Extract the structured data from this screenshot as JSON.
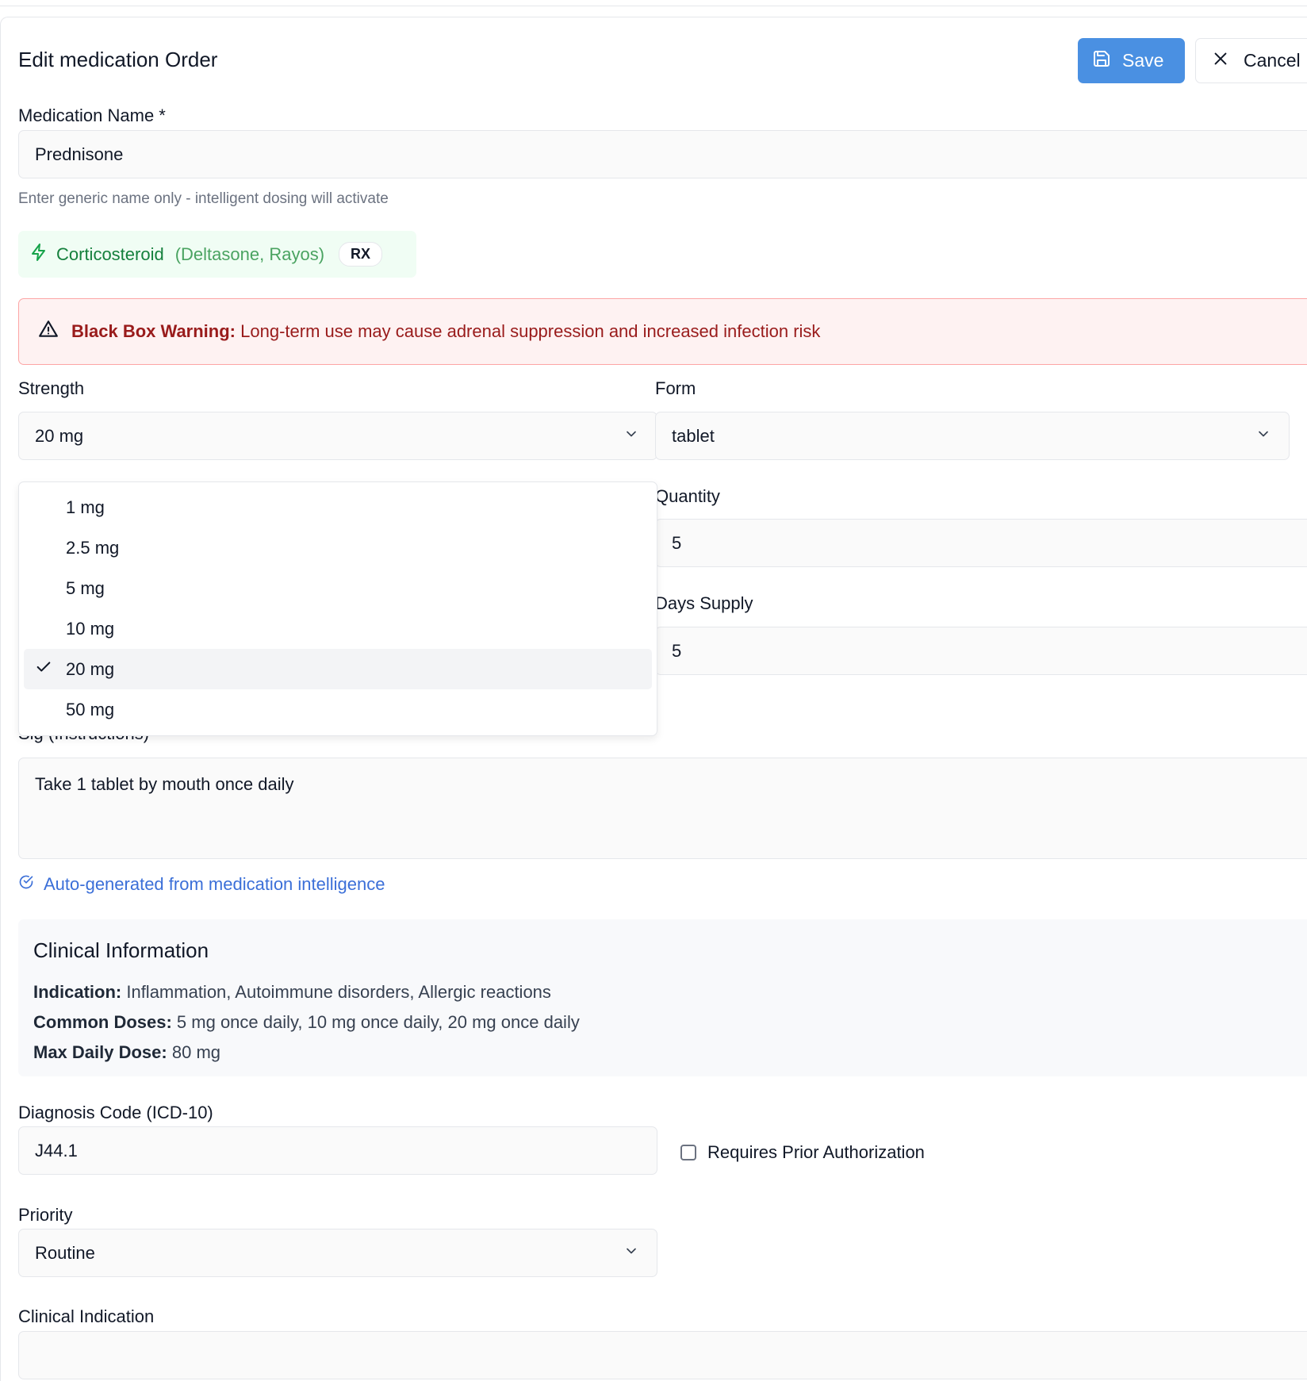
{
  "header": {
    "title": "Edit medication Order",
    "save_label": "Save",
    "cancel_label": "Cancel"
  },
  "medication_name": {
    "label": "Medication Name *",
    "value": "Prednisone",
    "hint": "Enter generic name only - intelligent dosing will activate"
  },
  "intelligence": {
    "drug_class": "Corticosteroid",
    "brands": "(Deltasone, Rayos)",
    "badge": "RX",
    "accent_color": "#15803d"
  },
  "warning": {
    "title": "Black Box Warning:",
    "text": "Long-term use may cause adrenal suppression and increased infection risk",
    "color": "#991b1b"
  },
  "strength": {
    "label": "Strength",
    "value": "20 mg",
    "options": [
      "1 mg",
      "2.5 mg",
      "5 mg",
      "10 mg",
      "20 mg",
      "50 mg"
    ],
    "selected_index": 4
  },
  "form": {
    "label": "Form",
    "value": "tablet"
  },
  "quantity": {
    "label": "Quantity",
    "value": "5"
  },
  "days_supply": {
    "label": "Days Supply",
    "value": "5"
  },
  "sig": {
    "label": "Sig (Instructions)",
    "value": "Take 1 tablet by mouth once daily",
    "auto_note": "Auto-generated from medication intelligence"
  },
  "clinical": {
    "title": "Clinical Information",
    "indication_label": "Indication:",
    "indication": "Inflammation, Autoimmune disorders, Allergic reactions",
    "common_doses_label": "Common Doses:",
    "common_doses": "5 mg once daily, 10 mg once daily, 20 mg once daily",
    "max_dose_label": "Max Daily Dose:",
    "max_dose": "80 mg"
  },
  "diagnosis": {
    "label": "Diagnosis Code (ICD-10)",
    "value": "J44.1"
  },
  "prior_auth": {
    "label": "Requires Prior Authorization",
    "checked": false
  },
  "priority": {
    "label": "Priority",
    "value": "Routine"
  },
  "clinical_indication": {
    "label": "Clinical Indication"
  },
  "colors": {
    "primary": "#4a90e2",
    "link": "#3b6fd8"
  }
}
